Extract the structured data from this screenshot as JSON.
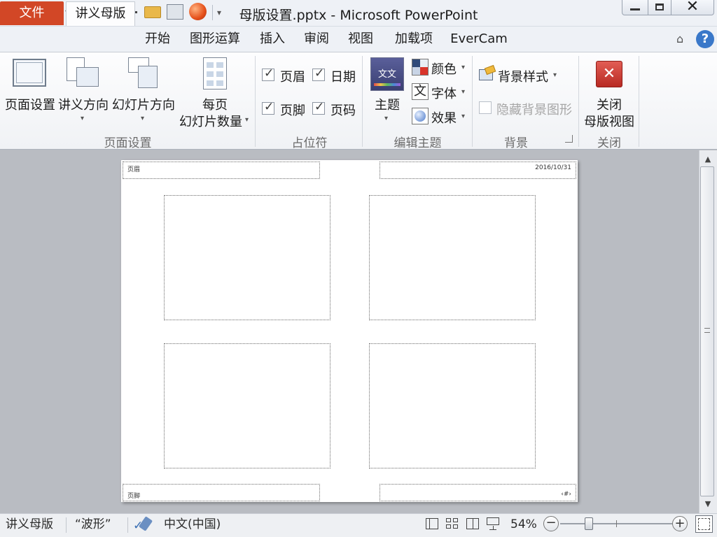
{
  "window": {
    "title": "母版设置.pptx - Microsoft PowerPoint"
  },
  "tabs": {
    "file": "文件",
    "items": [
      "讲义母版",
      "开始",
      "图形运算",
      "插入",
      "审阅",
      "视图",
      "加载项",
      "EverCam"
    ]
  },
  "ribbon": {
    "page_setup_group": {
      "label": "页面设置",
      "page_setup": "页面设置",
      "handout_orientation": "讲义方向",
      "slide_orientation": "幻灯片方向",
      "slides_per_page_line1": "每页",
      "slides_per_page_line2": "幻灯片数量"
    },
    "placeholders_group": {
      "label": "占位符",
      "header": "页眉",
      "date": "日期",
      "footer": "页脚",
      "page_number": "页码"
    },
    "edit_theme_group": {
      "label": "编辑主题",
      "themes": "主题",
      "colors": "颜色",
      "fonts": "字体",
      "effects": "效果",
      "font_icon_glyph": "文",
      "theme_thumb_text": "文文"
    },
    "background_group": {
      "label": "背景",
      "background_styles": "背景样式",
      "hide_background": "隐藏背景图形"
    },
    "close_group": {
      "label": "关闭",
      "close_line1": "关闭",
      "close_line2": "母版视图"
    }
  },
  "handout": {
    "header_text": "页眉",
    "date_text": "2016/10/31",
    "footer_text": "页脚",
    "page_number_text": "‹#›"
  },
  "statusbar": {
    "view_name": "讲义母版",
    "theme_name": "“波形”",
    "language": "中文(中国)",
    "zoom": "54%",
    "zoom_fraction": 0.54
  },
  "colors": {
    "file_tab": "#d24726",
    "close_button": "#c9302c"
  }
}
